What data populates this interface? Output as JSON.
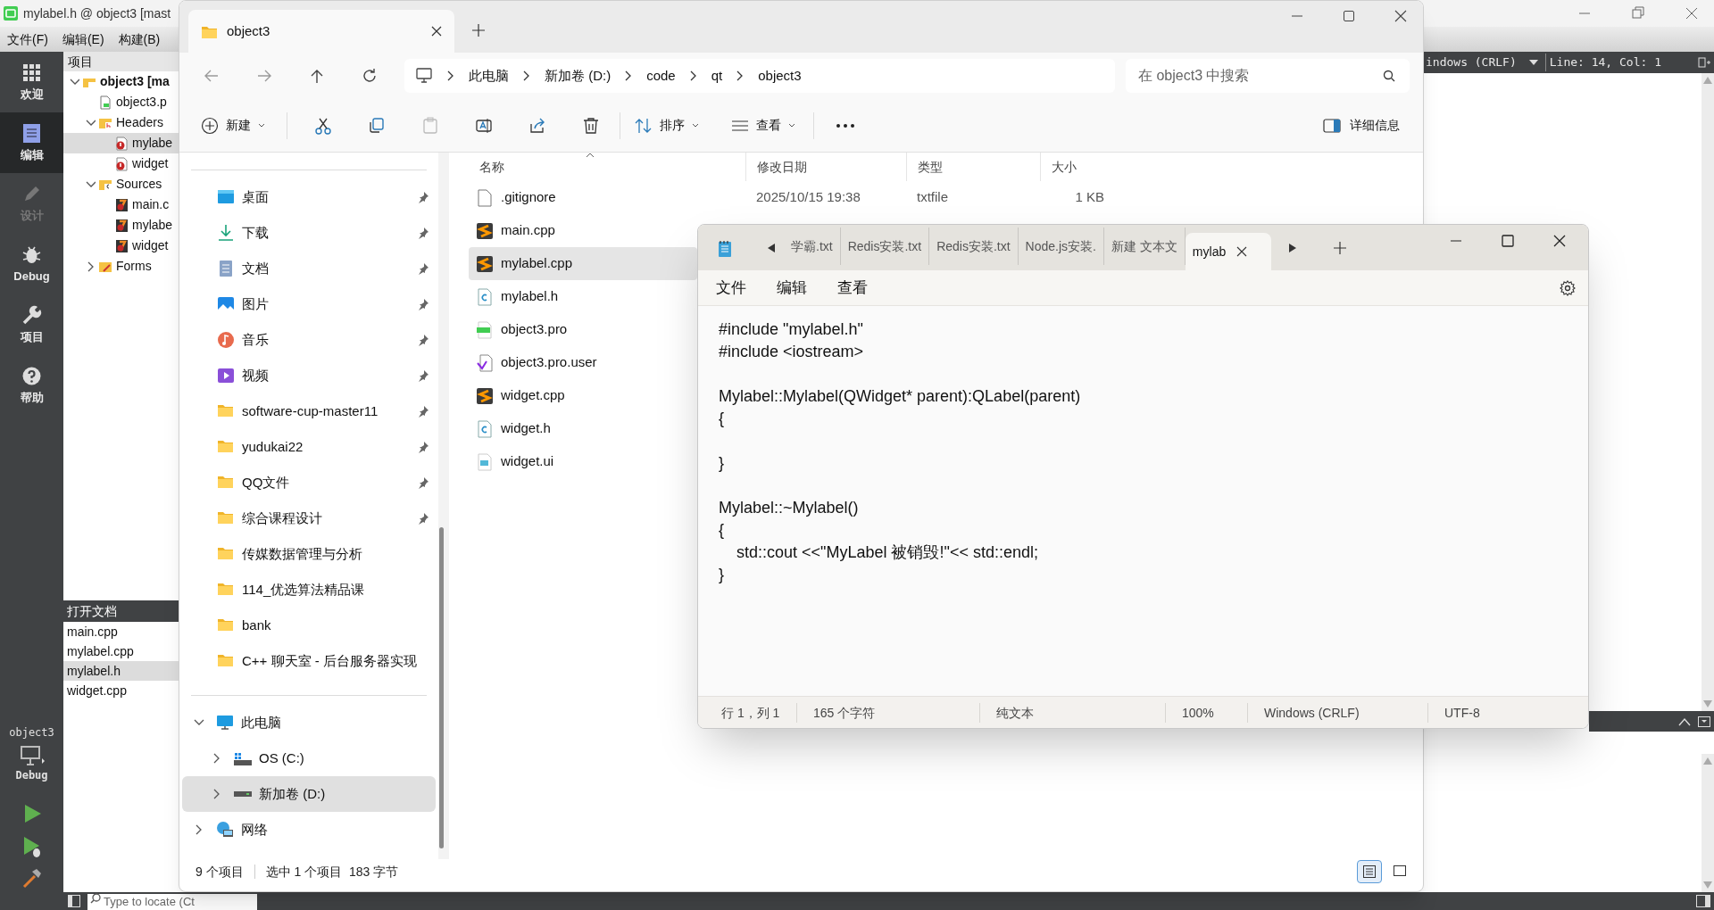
{
  "qt": {
    "title": "mylabel.h @ object3 [mast",
    "menus": [
      "文件(F)",
      "编辑(E)",
      "构建(B)"
    ],
    "modes": [
      {
        "label": "欢迎",
        "kind": "welcome",
        "selected": false,
        "disabled": false
      },
      {
        "label": "编辑",
        "kind": "edit",
        "selected": true,
        "disabled": false
      },
      {
        "label": "设计",
        "kind": "design",
        "selected": false,
        "disabled": true
      },
      {
        "label": "Debug",
        "kind": "debug",
        "selected": false,
        "disabled": false
      },
      {
        "label": "项目",
        "kind": "projects",
        "selected": false,
        "disabled": false
      },
      {
        "label": "帮助",
        "kind": "help",
        "selected": false,
        "disabled": false
      }
    ],
    "projects": {
      "title": "项目",
      "tree": [
        {
          "label": "object3 [ma",
          "kind": "project",
          "expanded": true,
          "selected": false,
          "children": [
            {
              "label": "object3.p",
              "kind": "pro",
              "selected": false
            },
            {
              "label": "Headers",
              "kind": "headers",
              "expanded": true,
              "selected": false,
              "children": [
                {
                  "label": "mylabe",
                  "kind": "header-file",
                  "selected": true
                },
                {
                  "label": "widget",
                  "kind": "header-file",
                  "selected": false
                }
              ]
            },
            {
              "label": "Sources",
              "kind": "sources",
              "expanded": true,
              "selected": false,
              "children": [
                {
                  "label": "main.c",
                  "kind": "source-file",
                  "selected": false
                },
                {
                  "label": "mylabe",
                  "kind": "source-file",
                  "selected": false
                },
                {
                  "label": "widget",
                  "kind": "source-file",
                  "selected": false
                }
              ]
            },
            {
              "label": "Forms",
              "kind": "forms",
              "expanded": false,
              "selected": false
            }
          ]
        }
      ]
    },
    "open_documents": {
      "title": "打开文档",
      "items": [
        {
          "label": "main.cpp",
          "selected": false
        },
        {
          "label": "mylabel.cpp",
          "selected": false
        },
        {
          "label": "mylabel.h",
          "selected": true
        },
        {
          "label": "widget.cpp",
          "selected": false
        }
      ]
    },
    "kit": {
      "project": "object3",
      "build": "Debug"
    },
    "editor_toolbar": {
      "line_ending": "indows (CRLF)",
      "position": "Line: 14, Col: 1"
    },
    "locator": {
      "placeholder": "Type to locate (Ct"
    }
  },
  "explorer": {
    "tab": "object3",
    "breadcrumb": [
      "此电脑",
      "新加卷 (D:)",
      "code",
      "qt",
      "object3"
    ],
    "search": {
      "placeholder": "在 object3 中搜索"
    },
    "toolbar": {
      "new": "新建",
      "sort": "排序",
      "view": "查看",
      "details": "详细信息"
    },
    "quick_access": [
      {
        "label": "桌面",
        "kind": "desktop",
        "pinned": true
      },
      {
        "label": "下载",
        "kind": "download",
        "pinned": true
      },
      {
        "label": "文档",
        "kind": "documents",
        "pinned": true
      },
      {
        "label": "图片",
        "kind": "pictures",
        "pinned": true
      },
      {
        "label": "音乐",
        "kind": "music",
        "pinned": true
      },
      {
        "label": "视频",
        "kind": "videos",
        "pinned": true
      },
      {
        "label": "software-cup-master11",
        "kind": "folder",
        "pinned": true
      },
      {
        "label": "yudukai22",
        "kind": "folder",
        "pinned": true
      },
      {
        "label": "QQ文件",
        "kind": "folder",
        "pinned": true
      },
      {
        "label": "综合课程设计",
        "kind": "folder",
        "pinned": true
      },
      {
        "label": "传媒数据管理与分析",
        "kind": "folder",
        "pinned": false
      },
      {
        "label": "114_优选算法精品课",
        "kind": "folder",
        "pinned": false
      },
      {
        "label": "bank",
        "kind": "folder",
        "pinned": false
      },
      {
        "label": "C++ 聊天室 - 后台服务器实现",
        "kind": "folder",
        "pinned": false
      }
    ],
    "tree": [
      {
        "label": "此电脑",
        "kind": "pc",
        "expanded": true,
        "selected": false,
        "children": [
          {
            "label": "OS (C:)",
            "kind": "os-drive",
            "expanded": false,
            "selected": false
          },
          {
            "label": "新加卷 (D:)",
            "kind": "drive",
            "expanded": false,
            "selected": true
          }
        ]
      },
      {
        "label": "网络",
        "kind": "network",
        "expanded": false,
        "selected": false
      }
    ],
    "columns": [
      "名称",
      "修改日期",
      "类型",
      "大小"
    ],
    "files": [
      {
        "name": ".gitignore",
        "kind": "text",
        "selected": false,
        "date": "2025/10/15 19:38",
        "type": "txtfile",
        "size": "1 KB"
      },
      {
        "name": "main.cpp",
        "kind": "sublime",
        "selected": false
      },
      {
        "name": "mylabel.cpp",
        "kind": "sublime",
        "selected": true
      },
      {
        "name": "mylabel.h",
        "kind": "c-file",
        "selected": false
      },
      {
        "name": "object3.pro",
        "kind": "pro",
        "selected": false
      },
      {
        "name": "object3.pro.user",
        "kind": "vs-file",
        "selected": false
      },
      {
        "name": "widget.cpp",
        "kind": "sublime",
        "selected": false
      },
      {
        "name": "widget.h",
        "kind": "c-file",
        "selected": false
      },
      {
        "name": "widget.ui",
        "kind": "ui-file",
        "selected": false
      }
    ],
    "status": {
      "count": "9 个项目",
      "selection": "选中 1 个项目  183 字节"
    },
    "views": [
      {
        "kind": "details",
        "selected": true
      },
      {
        "kind": "tiles",
        "selected": false
      }
    ]
  },
  "notepad": {
    "tabs": [
      {
        "label": "学霸.txt",
        "selected": false
      },
      {
        "label": "Redis安装.txt",
        "selected": false
      },
      {
        "label": "Redis安装.txt",
        "selected": false
      },
      {
        "label": "Node.js安装.",
        "selected": false
      },
      {
        "label": "新建 文本文",
        "selected": false
      },
      {
        "label": "mylab",
        "selected": true
      }
    ],
    "menus": [
      "文件",
      "编辑",
      "查看"
    ],
    "text": "#include \"mylabel.h\"\n#include <iostream>\n\nMylabel::Mylabel(QWidget* parent):QLabel(parent)\n{\n\n}\n\nMylabel::~Mylabel()\n{\n    std::cout <<\"MyLabel 被销毁!\"<< std::endl;\n}",
    "status": [
      "行 1，列 1",
      "165 个字符",
      "纯文本",
      "100%",
      "Windows (CRLF)",
      "UTF-8"
    ]
  }
}
